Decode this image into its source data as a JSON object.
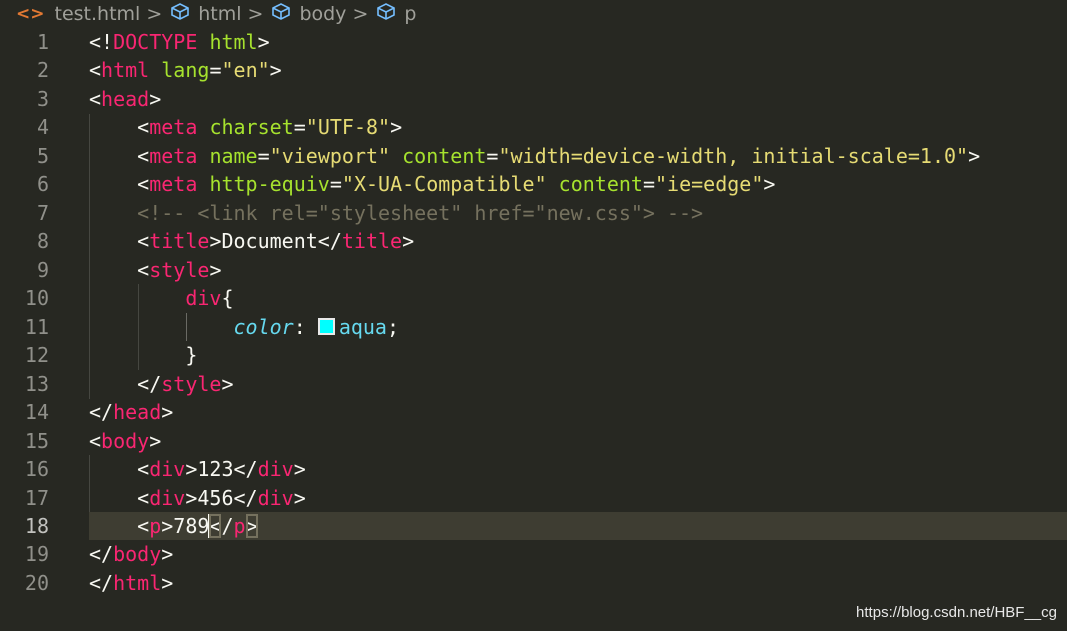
{
  "breadcrumb": [
    {
      "label": "test.html",
      "icon": "html-file-icon"
    },
    {
      "label": "html",
      "icon": "cube-element-icon"
    },
    {
      "label": "body",
      "icon": "cube-element-icon"
    },
    {
      "label": "p",
      "icon": "cube-element-icon"
    }
  ],
  "colors": {
    "background": "#272822",
    "tag": "#f92672",
    "attribute": "#a6e22e",
    "string": "#e6db74",
    "comment": "#75715e",
    "property": "#66d9ef",
    "swatch": "#00ffff"
  },
  "active_line": 18,
  "lines": [
    [
      [
        "p",
        "<!"
      ],
      [
        "tag",
        "DOCTYPE"
      ],
      [
        "p",
        " "
      ],
      [
        "attr",
        "html"
      ],
      [
        "p",
        ">"
      ]
    ],
    [
      [
        "p",
        "<"
      ],
      [
        "tag",
        "html"
      ],
      [
        "p",
        " "
      ],
      [
        "attr",
        "lang"
      ],
      [
        "p",
        "="
      ],
      [
        "str",
        "\"en\""
      ],
      [
        "p",
        ">"
      ]
    ],
    [
      [
        "p",
        "<"
      ],
      [
        "tag",
        "head"
      ],
      [
        "p",
        ">"
      ]
    ],
    [
      [
        "p",
        "    <"
      ],
      [
        "tag",
        "meta"
      ],
      [
        "p",
        " "
      ],
      [
        "attr",
        "charset"
      ],
      [
        "p",
        "="
      ],
      [
        "str",
        "\"UTF-8\""
      ],
      [
        "p",
        ">"
      ]
    ],
    [
      [
        "p",
        "    <"
      ],
      [
        "tag",
        "meta"
      ],
      [
        "p",
        " "
      ],
      [
        "attr",
        "name"
      ],
      [
        "p",
        "="
      ],
      [
        "str",
        "\"viewport\""
      ],
      [
        "p",
        " "
      ],
      [
        "attr",
        "content"
      ],
      [
        "p",
        "="
      ],
      [
        "str",
        "\"width=device-width, initial-scale=1.0\""
      ],
      [
        "p",
        ">"
      ]
    ],
    [
      [
        "p",
        "    <"
      ],
      [
        "tag",
        "meta"
      ],
      [
        "p",
        " "
      ],
      [
        "attr",
        "http-equiv"
      ],
      [
        "p",
        "="
      ],
      [
        "str",
        "\"X-UA-Compatible\""
      ],
      [
        "p",
        " "
      ],
      [
        "attr",
        "content"
      ],
      [
        "p",
        "="
      ],
      [
        "str",
        "\"ie=edge\""
      ],
      [
        "p",
        ">"
      ]
    ],
    [
      [
        "p",
        "    "
      ],
      [
        "cm",
        "<!-- <link rel=\"stylesheet\" href=\"new.css\"> -->"
      ]
    ],
    [
      [
        "p",
        "    <"
      ],
      [
        "tag",
        "title"
      ],
      [
        "p",
        ">Document</"
      ],
      [
        "tag",
        "title"
      ],
      [
        "p",
        ">"
      ]
    ],
    [
      [
        "p",
        "    <"
      ],
      [
        "tag",
        "style"
      ],
      [
        "p",
        ">"
      ]
    ],
    [
      [
        "p",
        "        "
      ],
      [
        "tag",
        "div"
      ],
      [
        "p",
        "{"
      ]
    ],
    [
      [
        "p",
        "            "
      ],
      [
        "prop",
        "color"
      ],
      [
        "p",
        ": "
      ],
      [
        "swatch",
        ""
      ],
      [
        "val",
        "aqua"
      ],
      [
        "p",
        ";"
      ]
    ],
    [
      [
        "p",
        "        }"
      ]
    ],
    [
      [
        "p",
        "    </"
      ],
      [
        "tag",
        "style"
      ],
      [
        "p",
        ">"
      ]
    ],
    [
      [
        "p",
        "</"
      ],
      [
        "tag",
        "head"
      ],
      [
        "p",
        ">"
      ]
    ],
    [
      [
        "p",
        "<"
      ],
      [
        "tag",
        "body"
      ],
      [
        "p",
        ">"
      ]
    ],
    [
      [
        "p",
        "    <"
      ],
      [
        "tag",
        "div"
      ],
      [
        "p",
        ">123</"
      ],
      [
        "tag",
        "div"
      ],
      [
        "p",
        ">"
      ]
    ],
    [
      [
        "p",
        "    <"
      ],
      [
        "tag",
        "div"
      ],
      [
        "p",
        ">456</"
      ],
      [
        "tag",
        "div"
      ],
      [
        "p",
        ">"
      ]
    ],
    [
      [
        "p",
        "    <"
      ],
      [
        "tag",
        "p"
      ],
      [
        "p",
        ">789"
      ],
      [
        "cursor",
        ""
      ],
      [
        "bracket",
        "<"
      ],
      [
        "p",
        "/"
      ],
      [
        "tag",
        "p"
      ],
      [
        "bracket",
        ">"
      ]
    ],
    [
      [
        "p",
        "</"
      ],
      [
        "tag",
        "body"
      ],
      [
        "p",
        ">"
      ]
    ],
    [
      [
        "p",
        "</"
      ],
      [
        "tag",
        "html"
      ],
      [
        "p",
        ">"
      ]
    ]
  ],
  "watermark": "https://blog.csdn.net/HBF__cg"
}
